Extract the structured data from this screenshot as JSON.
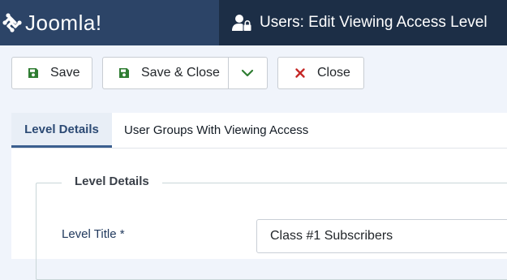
{
  "brand": {
    "name": "Joomla!",
    "icon": "joomla-logo-icon"
  },
  "header": {
    "title": "Users: Edit Viewing Access Level",
    "icon": "user-lock-icon"
  },
  "toolbar": {
    "save_label": "Save",
    "save_close_label": "Save & Close",
    "close_label": "Close",
    "save_icon": "save-icon",
    "close_icon": "close-icon",
    "dropdown_icon": "chevron-down-icon",
    "colors": {
      "save_icon": "#2f7d32",
      "close_icon": "#c52827"
    }
  },
  "tabs": [
    {
      "label": "Level Details",
      "active": true
    },
    {
      "label": "User Groups With Viewing Access",
      "active": false
    }
  ],
  "form": {
    "legend": "Level Details",
    "level_title_label": "Level Title *",
    "level_title_value": "Class #1 Subscribers"
  }
}
